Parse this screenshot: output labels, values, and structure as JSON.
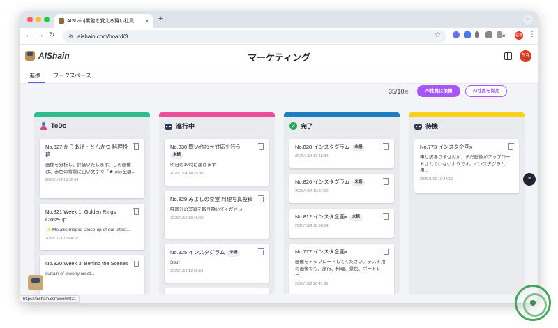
{
  "browser": {
    "tab_title": "AIShain|業務を覚える賢い社員",
    "url": "aishain.com/board/3",
    "status_url": "https://aishain.com/work/821",
    "profile_label": "右寺"
  },
  "app": {
    "logo_text": "AIShain",
    "page_title": "マーケティング",
    "avatar_label": "左寺",
    "tabs": [
      "進捗",
      "ワークスペース"
    ],
    "count": "35/10",
    "count_unit": "枚",
    "request_button": "AI社員に依頼",
    "hire_button": "AI社員を採用"
  },
  "colors": {
    "todo": "#2ebd8a",
    "in_progress": "#ec4f98",
    "done": "#1e7fc0",
    "waiting": "#f7d317",
    "accent": "#a855f7"
  },
  "columns": [
    {
      "title": "ToDo",
      "icon": "person-icon",
      "cards": [
        {
          "title": "No.827 からあげ・とんかつ 料理投稿",
          "badge": "",
          "desc": "画像を分析し、評価いたします。この画像は、赤色の背景に白い文字で「★ほぼ全額...",
          "date": "2025/1/14 13:38:04"
        },
        {
          "title": "No.821 Week 1: Golden Rings Close-up",
          "badge": "",
          "desc": "✨ Metallic magic! Close-up of our latest...",
          "date": "2025/1/14 18:44:10"
        },
        {
          "title": "No.820 Week 3: Behind the Scenes",
          "badge": "",
          "desc": "curtain of jewelry creat...",
          "date": ""
        }
      ]
    },
    {
      "title": "進行中",
      "icon": "robot-icon",
      "cards": [
        {
          "title": "No.830 問い合わせ対応を行う",
          "badge": "未読",
          "desc": "明日の10時に届けます",
          "date": "2025/1/14 14:25:30"
        },
        {
          "title": "No.829 みよしの食堂 料理写真投稿",
          "badge": "",
          "desc": "味噌汁の写真を取り除いてください",
          "date": "2025/1/14 13:45:09"
        },
        {
          "title": "No.825 インスタグラム",
          "badge": "未読",
          "desc": "Start",
          "date": "2025/1/14 13:35:53"
        }
      ]
    },
    {
      "title": "完了",
      "icon": "check-circle-icon",
      "cards": [
        {
          "title": "No.828 インスタグラム",
          "badge": "未読",
          "desc": "",
          "date": "2025/1/14 13:45:34"
        },
        {
          "title": "No.826 インスタグラム",
          "badge": "未読",
          "desc": "",
          "date": "2025/1/14 13:37:50"
        },
        {
          "title": "No.812 インスタ企画x",
          "badge": "未読",
          "desc": "",
          "date": "2025/1/14 18:38:04"
        },
        {
          "title": "No.772 インスタ企画x",
          "badge": "",
          "desc": "画像をアップロードしてください。テスト用の画像でも、旅行、料理、景色、ポートレー...",
          "date": "2025/1/12 10:41:36"
        }
      ]
    },
    {
      "title": "待機",
      "icon": "robot-icon",
      "cards": [
        {
          "title": "No.773 インスタ企画x",
          "badge": "",
          "desc": "申し訳ありませんが、まだ画像がアップロードされていないようです。インスタグラム用...",
          "date": "2025/1/12 10:44:19"
        }
      ]
    }
  ]
}
